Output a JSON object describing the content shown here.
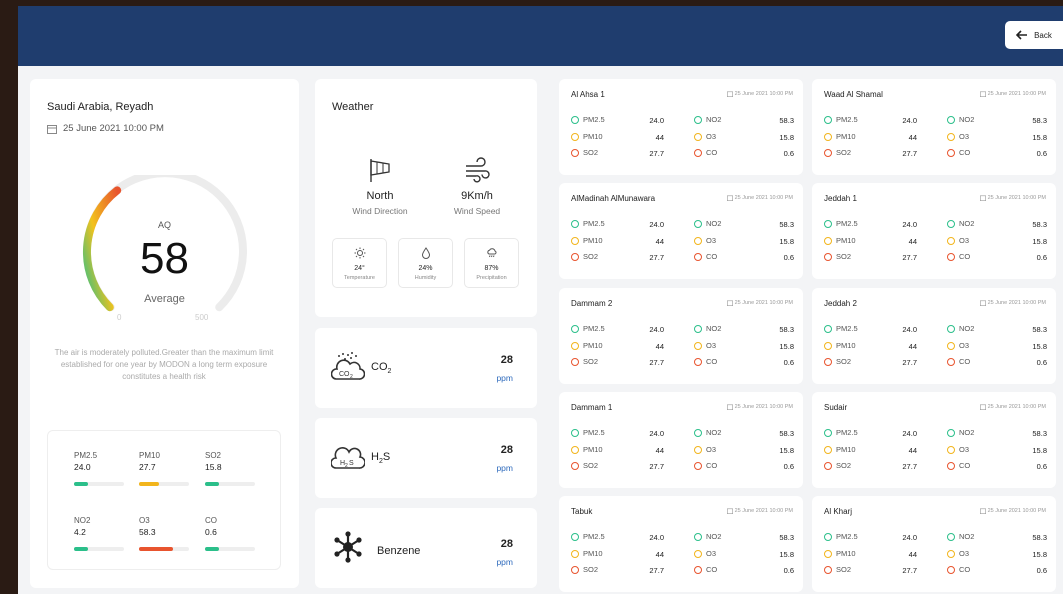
{
  "header": {
    "back_label": "Back"
  },
  "summary": {
    "location": "Saudi Arabia, Reyadh",
    "datetime": "25 June 2021 10:00 PM",
    "aq_label": "AQ",
    "aq_value": "58",
    "aq_status": "Average",
    "scale_min": "0",
    "scale_max": "500",
    "aq_fraction": 0.116,
    "description": "The air is moderately polluted.Greater than the maximum limit established for one year by MODON a long term exposure constitutes a health risk",
    "pollutants": [
      {
        "name": "PM2.5",
        "value": "24.0",
        "level": 0.28,
        "color": "#2bbf8a"
      },
      {
        "name": "PM10",
        "value": "27.7",
        "level": 0.4,
        "color": "#f2b51c"
      },
      {
        "name": "SO2",
        "value": "15.8",
        "level": 0.28,
        "color": "#2bbf8a"
      },
      {
        "name": "NO2",
        "value": "4.2",
        "level": 0.28,
        "color": "#2bbf8a"
      },
      {
        "name": "O3",
        "value": "58.3",
        "level": 0.68,
        "color": "#e8542e"
      },
      {
        "name": "CO",
        "value": "0.6",
        "level": 0.28,
        "color": "#2bbf8a"
      }
    ]
  },
  "weather": {
    "title": "Weather",
    "wind_direction": {
      "value": "North",
      "label": "Wind Direction",
      "icon": "wind-sock-icon"
    },
    "wind_speed": {
      "value": "9Km/h",
      "label": "Wind Speed",
      "icon": "wind-icon"
    },
    "temperature": {
      "value": "24°",
      "label": "Temperature",
      "icon": "sun-icon"
    },
    "humidity": {
      "value": "24%",
      "label": "Humidity",
      "icon": "droplet-icon"
    },
    "precipitation": {
      "value": "87%",
      "label": "Precipitation",
      "icon": "rain-cloud-icon"
    }
  },
  "gases": [
    {
      "name": "CO",
      "sub": "2",
      "value": "28",
      "unit": "ppm",
      "icon": "co2-cloud-icon"
    },
    {
      "name": "H",
      "sub": "2",
      "tail": "S",
      "value": "28",
      "unit": "ppm",
      "icon": "h2s-cloud-icon"
    },
    {
      "name": "Benzene",
      "value": "28",
      "unit": "ppm",
      "icon": "benzene-molecule-icon"
    }
  ],
  "colors": {
    "green": "#2bbf8a",
    "yellow": "#f2b51c",
    "red": "#e8542e",
    "brand": "#1f3d6e"
  },
  "stations": [
    {
      "name": "Al Ahsa 1",
      "date": "25 June 2021 10:00 PM",
      "readings": [
        {
          "name": "PM2.5",
          "value": "24.0",
          "status": "green"
        },
        {
          "name": "PM10",
          "value": "44",
          "status": "yellow"
        },
        {
          "name": "SO2",
          "value": "27.7",
          "status": "red"
        },
        {
          "name": "NO2",
          "value": "58.3",
          "status": "green"
        },
        {
          "name": "O3",
          "value": "15.8",
          "status": "yellow"
        },
        {
          "name": "CO",
          "value": "0.6",
          "status": "red"
        }
      ]
    },
    {
      "name": "Waad Al Shamal",
      "date": "25 June 2021 10:00 PM",
      "readings": [
        {
          "name": "PM2.5",
          "value": "24.0",
          "status": "green"
        },
        {
          "name": "PM10",
          "value": "44",
          "status": "yellow"
        },
        {
          "name": "SO2",
          "value": "27.7",
          "status": "red"
        },
        {
          "name": "NO2",
          "value": "58.3",
          "status": "green"
        },
        {
          "name": "O3",
          "value": "15.8",
          "status": "yellow"
        },
        {
          "name": "CO",
          "value": "0.6",
          "status": "red"
        }
      ]
    },
    {
      "name": "AlMadinah AlMunawara",
      "date": "25 June 2021 10:00 PM",
      "readings": [
        {
          "name": "PM2.5",
          "value": "24.0",
          "status": "green"
        },
        {
          "name": "PM10",
          "value": "44",
          "status": "yellow"
        },
        {
          "name": "SO2",
          "value": "27.7",
          "status": "red"
        },
        {
          "name": "NO2",
          "value": "58.3",
          "status": "green"
        },
        {
          "name": "O3",
          "value": "15.8",
          "status": "yellow"
        },
        {
          "name": "CO",
          "value": "0.6",
          "status": "red"
        }
      ]
    },
    {
      "name": "Jeddah 1",
      "date": "25 June 2021 10:00 PM",
      "readings": [
        {
          "name": "PM2.5",
          "value": "24.0",
          "status": "green"
        },
        {
          "name": "PM10",
          "value": "44",
          "status": "yellow"
        },
        {
          "name": "SO2",
          "value": "27.7",
          "status": "red"
        },
        {
          "name": "NO2",
          "value": "58.3",
          "status": "green"
        },
        {
          "name": "O3",
          "value": "15.8",
          "status": "yellow"
        },
        {
          "name": "CO",
          "value": "0.6",
          "status": "red"
        }
      ]
    },
    {
      "name": "Dammam 2",
      "date": "25 June 2021 10:00 PM",
      "readings": [
        {
          "name": "PM2.5",
          "value": "24.0",
          "status": "green"
        },
        {
          "name": "PM10",
          "value": "44",
          "status": "yellow"
        },
        {
          "name": "SO2",
          "value": "27.7",
          "status": "red"
        },
        {
          "name": "NO2",
          "value": "58.3",
          "status": "green"
        },
        {
          "name": "O3",
          "value": "15.8",
          "status": "yellow"
        },
        {
          "name": "CO",
          "value": "0.6",
          "status": "red"
        }
      ]
    },
    {
      "name": "Jeddah 2",
      "date": "25 June 2021 10:00 PM",
      "readings": [
        {
          "name": "PM2.5",
          "value": "24.0",
          "status": "green"
        },
        {
          "name": "PM10",
          "value": "44",
          "status": "yellow"
        },
        {
          "name": "SO2",
          "value": "27.7",
          "status": "red"
        },
        {
          "name": "NO2",
          "value": "58.3",
          "status": "green"
        },
        {
          "name": "O3",
          "value": "15.8",
          "status": "yellow"
        },
        {
          "name": "CO",
          "value": "0.6",
          "status": "red"
        }
      ]
    },
    {
      "name": "Dammam 1",
      "date": "25 June 2021 10:00 PM",
      "readings": [
        {
          "name": "PM2.5",
          "value": "24.0",
          "status": "green"
        },
        {
          "name": "PM10",
          "value": "44",
          "status": "yellow"
        },
        {
          "name": "SO2",
          "value": "27.7",
          "status": "red"
        },
        {
          "name": "NO2",
          "value": "58.3",
          "status": "green"
        },
        {
          "name": "O3",
          "value": "15.8",
          "status": "yellow"
        },
        {
          "name": "CO",
          "value": "0.6",
          "status": "red"
        }
      ]
    },
    {
      "name": "Sudair",
      "date": "25 June 2021 10:00 PM",
      "readings": [
        {
          "name": "PM2.5",
          "value": "24.0",
          "status": "green"
        },
        {
          "name": "PM10",
          "value": "44",
          "status": "yellow"
        },
        {
          "name": "SO2",
          "value": "27.7",
          "status": "red"
        },
        {
          "name": "NO2",
          "value": "58.3",
          "status": "green"
        },
        {
          "name": "O3",
          "value": "15.8",
          "status": "yellow"
        },
        {
          "name": "CO",
          "value": "0.6",
          "status": "red"
        }
      ]
    },
    {
      "name": "Tabuk",
      "date": "25 June 2021 10:00 PM",
      "readings": [
        {
          "name": "PM2.5",
          "value": "24.0",
          "status": "green"
        },
        {
          "name": "PM10",
          "value": "44",
          "status": "yellow"
        },
        {
          "name": "SO2",
          "value": "27.7",
          "status": "red"
        },
        {
          "name": "NO2",
          "value": "58.3",
          "status": "green"
        },
        {
          "name": "O3",
          "value": "15.8",
          "status": "yellow"
        },
        {
          "name": "CO",
          "value": "0.6",
          "status": "red"
        }
      ]
    },
    {
      "name": "Al Kharj",
      "date": "25 June 2021 10:00 PM",
      "readings": [
        {
          "name": "PM2.5",
          "value": "24.0",
          "status": "green"
        },
        {
          "name": "PM10",
          "value": "44",
          "status": "yellow"
        },
        {
          "name": "SO2",
          "value": "27.7",
          "status": "red"
        },
        {
          "name": "NO2",
          "value": "58.3",
          "status": "green"
        },
        {
          "name": "O3",
          "value": "15.8",
          "status": "yellow"
        },
        {
          "name": "CO",
          "value": "0.6",
          "status": "red"
        }
      ]
    }
  ]
}
